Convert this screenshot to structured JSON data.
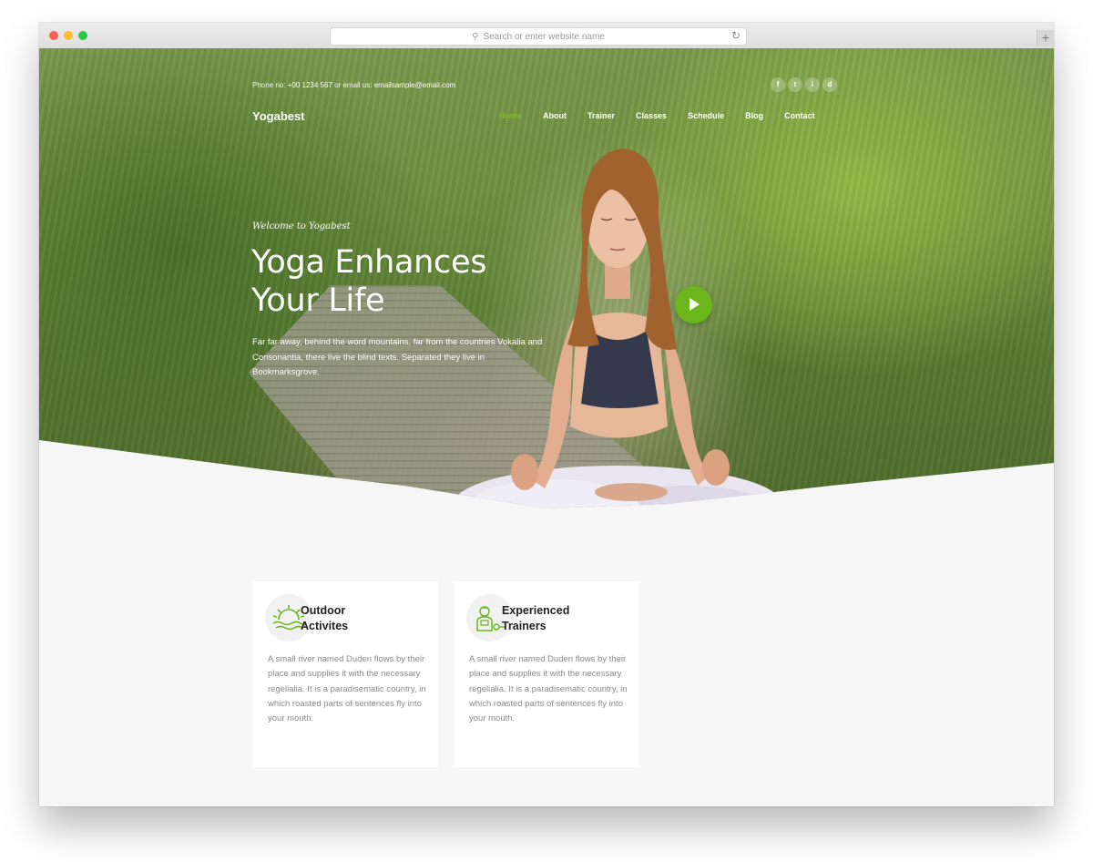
{
  "browser": {
    "address_placeholder": "Search or enter website name",
    "search_icon": "search-icon",
    "reload_icon": "reload-icon",
    "new_tab_label": "+"
  },
  "topbar": {
    "phone_label": "Phone no:",
    "phone": "+00 1234 567",
    "email_label": "or email us:",
    "email": "emailsample@email.com",
    "socials": [
      "f",
      "t",
      "i",
      "d"
    ]
  },
  "logo": "Yogabest",
  "nav": [
    "Home",
    "About",
    "Trainer",
    "Classes",
    "Schedule",
    "Blog",
    "Contact"
  ],
  "hero": {
    "welcome": "Welcome to Yogabest",
    "headline_line1": "Yoga Enhances",
    "headline_line2": "Your Life",
    "intro": "Far far away, behind the word mountains, far from the countries Vokalia and Consonantia, there live the blind texts. Separated they live in Bookmarksgrove.",
    "play_icon": "play-icon"
  },
  "features": [
    {
      "icon": "sun-icon",
      "title_line1": "Outdoor",
      "title_line2": "Activites",
      "description": "A small river named Duden flows by their place and supplies it with the necessary regelialia. It is a paradisematic country, in which roasted parts of sentences fly into your mouth."
    },
    {
      "icon": "trainer-icon",
      "title_line1": "Experienced",
      "title_line2": "Trainers",
      "description": "A small river named Duden flows by their place and supplies it with the necessary regelialia. It is a paradisematic country, in which roasted parts of sentences fly into your mouth."
    }
  ],
  "colors": {
    "accent": "#6bb61a",
    "nav_active": "#7ac11e",
    "page_bg": "#f6f6f6",
    "card_bg": "#ffffff"
  }
}
